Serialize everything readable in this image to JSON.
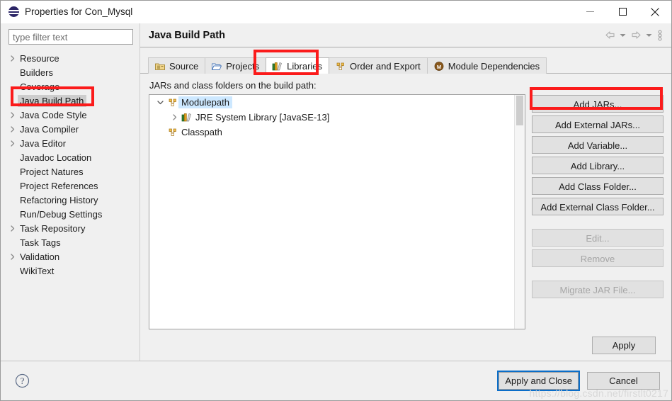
{
  "window": {
    "title": "Properties for Con_Mysql",
    "icon": "eclipse-icon",
    "controls": {
      "minimize": "minimize-icon",
      "maximize": "maximize-icon",
      "close": "close-icon"
    }
  },
  "sidebar": {
    "filter": {
      "placeholder": "type filter text",
      "value": ""
    },
    "items": [
      {
        "label": "Resource",
        "expandable": true,
        "selected": false
      },
      {
        "label": "Builders",
        "expandable": false,
        "selected": false
      },
      {
        "label": "Coverage",
        "expandable": false,
        "selected": false
      },
      {
        "label": "Java Build Path",
        "expandable": false,
        "selected": true
      },
      {
        "label": "Java Code Style",
        "expandable": true,
        "selected": false
      },
      {
        "label": "Java Compiler",
        "expandable": true,
        "selected": false
      },
      {
        "label": "Java Editor",
        "expandable": true,
        "selected": false
      },
      {
        "label": "Javadoc Location",
        "expandable": false,
        "selected": false
      },
      {
        "label": "Project Natures",
        "expandable": false,
        "selected": false
      },
      {
        "label": "Project References",
        "expandable": false,
        "selected": false
      },
      {
        "label": "Refactoring History",
        "expandable": false,
        "selected": false
      },
      {
        "label": "Run/Debug Settings",
        "expandable": false,
        "selected": false
      },
      {
        "label": "Task Repository",
        "expandable": true,
        "selected": false
      },
      {
        "label": "Task Tags",
        "expandable": false,
        "selected": false
      },
      {
        "label": "Validation",
        "expandable": true,
        "selected": false
      },
      {
        "label": "WikiText",
        "expandable": false,
        "selected": false
      }
    ]
  },
  "page": {
    "title": "Java Build Path",
    "nav": {
      "back": "back-arrow-icon",
      "back_menu": "chevron-down-icon",
      "forward": "forward-arrow-icon",
      "forward_menu": "chevron-down-icon",
      "overflow": "view-menu-icon"
    }
  },
  "tabs": [
    {
      "label": "Source",
      "icon": "source-folder-icon",
      "active": false
    },
    {
      "label": "Projects",
      "icon": "open-folder-icon",
      "active": false
    },
    {
      "label": "Libraries",
      "icon": "libraries-books-icon",
      "active": true
    },
    {
      "label": "Order and Export",
      "icon": "modulepath-icon",
      "active": false
    },
    {
      "label": "Module Dependencies",
      "icon": "module-circle-icon",
      "active": false
    }
  ],
  "main": {
    "list_caption": "JARs and class folders on the build path:",
    "tree": [
      {
        "label": "Modulepath",
        "icon": "modulepath-icon",
        "indent": 1,
        "twisty": "expanded",
        "selected": true
      },
      {
        "label": "JRE System Library [JavaSE-13]",
        "icon": "libraries-books-icon",
        "indent": 2,
        "twisty": "collapsed",
        "selected": false
      },
      {
        "label": "Classpath",
        "icon": "modulepath-icon",
        "indent": 1,
        "twisty": "none",
        "selected": false
      }
    ],
    "buttons": [
      {
        "label": "Add JARs...",
        "enabled": true
      },
      {
        "label": "Add External JARs...",
        "enabled": true
      },
      {
        "label": "Add Variable...",
        "enabled": true
      },
      {
        "label": "Add Library...",
        "enabled": true
      },
      {
        "label": "Add Class Folder...",
        "enabled": true
      },
      {
        "label": "Add External Class Folder...",
        "enabled": true
      },
      {
        "label": "Edit...",
        "enabled": false
      },
      {
        "label": "Remove",
        "enabled": false
      },
      {
        "label": "Migrate JAR File...",
        "enabled": false
      }
    ],
    "apply_label": "Apply"
  },
  "footer": {
    "help_icon": "help-question-icon",
    "apply_and_close_label": "Apply and Close",
    "cancel_label": "Cancel"
  },
  "watermark": "https://blog.csdn.net/firstlt0217",
  "colors": {
    "annotation": "#fb1b1b",
    "focus_ring": "#0b6ec9",
    "tree_selection": "#cde8ff",
    "sidebar_selection": "#cdcdcd",
    "window_chrome": "#f0f0f0"
  }
}
